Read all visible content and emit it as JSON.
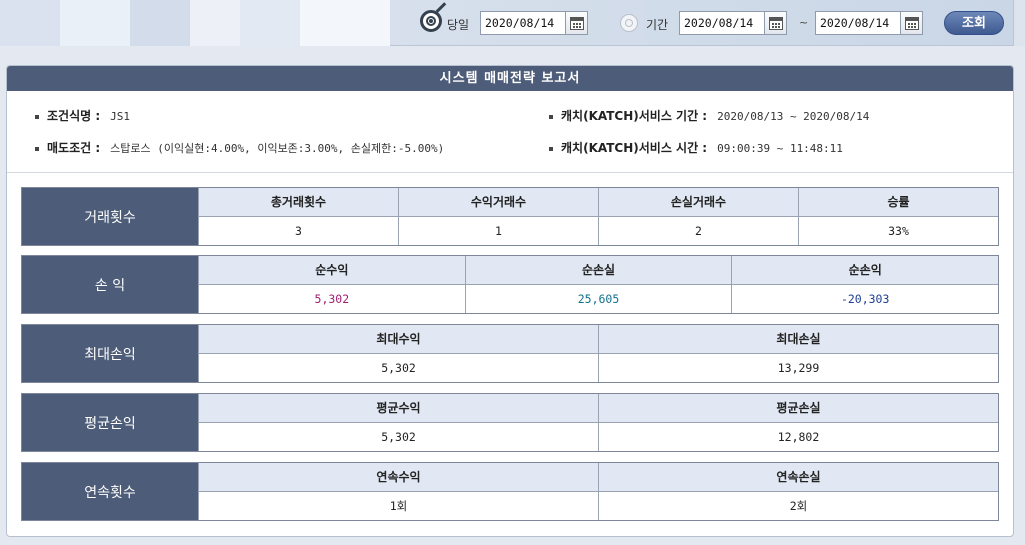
{
  "toolbar": {
    "today_label": "당일",
    "today_date": "2020/08/14",
    "period_label": "기간",
    "period_start": "2020/08/14",
    "period_sep": "~",
    "period_end": "2020/08/14",
    "search_label": "조회",
    "today_icon": "target-arrow-icon",
    "period_icon": "target-radio-icon",
    "calendar_icon": "calendar-icon"
  },
  "report": {
    "title": "시스템 매매전략 보고서",
    "condition_name_key": "조건식명 :",
    "condition_name_val": "JS1",
    "sell_cond_key": "매도조건 :",
    "sell_cond_val": "스탑로스 (이익실현:4.00%, 이익보존:3.00%, 손실제한:-5.00%)",
    "service_period_key": "캐치(KATCH)서비스 기간 :",
    "service_period_val": "2020/08/13 ~ 2020/08/14",
    "service_time_key": "캐치(KATCH)서비스 시간 :",
    "service_time_val": "09:00:39 ~ 11:48:11"
  },
  "tables": {
    "trades": {
      "head": "거래횟수",
      "cols": [
        "총거래횟수",
        "수익거래수",
        "손실거래수",
        "승률"
      ],
      "vals": [
        "3",
        "1",
        "2",
        "33%"
      ]
    },
    "pnl": {
      "head": "손 익",
      "cols": [
        "순수익",
        "순손실",
        "순손익"
      ],
      "vals": [
        "5,302",
        "25,605",
        "-20,303"
      ]
    },
    "max": {
      "head": "최대손익",
      "cols": [
        "최대수익",
        "최대손실"
      ],
      "vals": [
        "5,302",
        "13,299"
      ]
    },
    "avg": {
      "head": "평균손익",
      "cols": [
        "평균수익",
        "평균손실"
      ],
      "vals": [
        "5,302",
        "12,802"
      ]
    },
    "streak": {
      "head": "연속횟수",
      "cols": [
        "연속수익",
        "연속손실"
      ],
      "vals": [
        "1회",
        "2회"
      ]
    }
  },
  "colors": {
    "header_bg": "#4d5c78",
    "profit": "#a12171",
    "loss": "#11728c",
    "net": "#1d3e93"
  }
}
